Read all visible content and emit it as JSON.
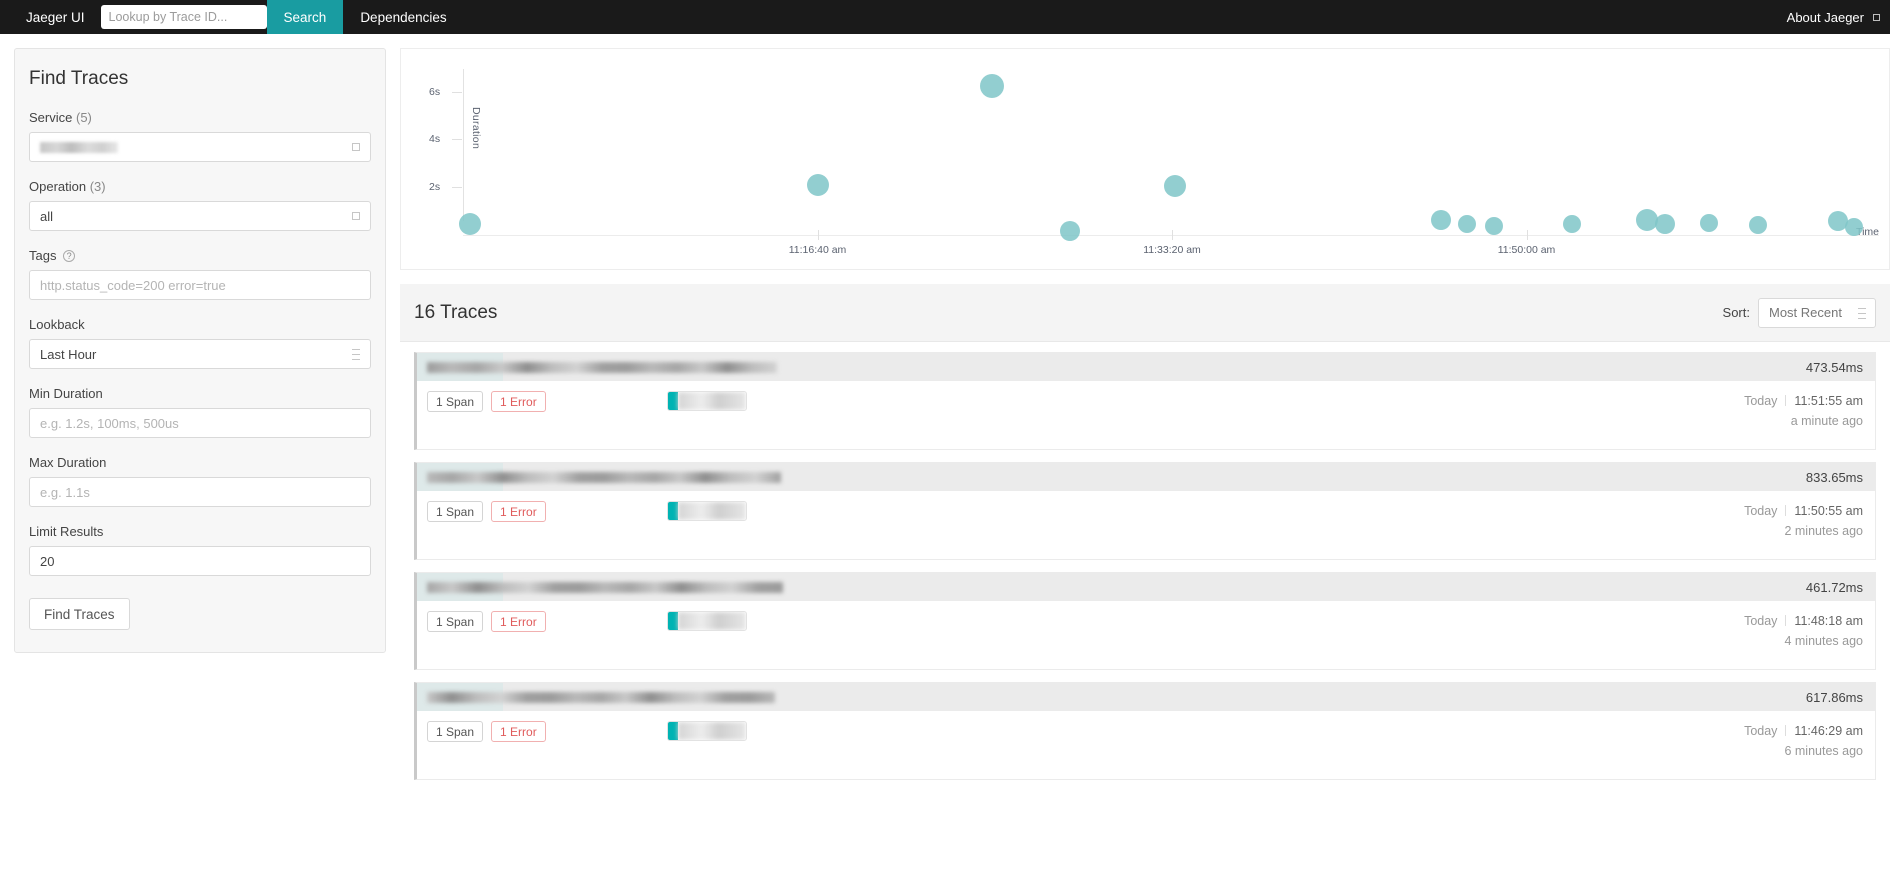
{
  "nav": {
    "brand": "Jaeger UI",
    "trace_id_placeholder": "Lookup by Trace ID...",
    "search_label": "Search",
    "dependencies_label": "Dependencies",
    "about_label": "About Jaeger"
  },
  "sidebar": {
    "title": "Find Traces",
    "service": {
      "label": "Service",
      "count": "(5)",
      "value": ""
    },
    "operation": {
      "label": "Operation",
      "count": "(3)",
      "value": "all"
    },
    "tags": {
      "label": "Tags",
      "placeholder": "http.status_code=200 error=true",
      "value": ""
    },
    "lookback": {
      "label": "Lookback",
      "value": "Last Hour"
    },
    "min_duration": {
      "label": "Min Duration",
      "placeholder": "e.g. 1.2s, 100ms, 500us",
      "value": ""
    },
    "max_duration": {
      "label": "Max Duration",
      "placeholder": "e.g. 1.1s",
      "value": ""
    },
    "limit_results": {
      "label": "Limit Results",
      "value": "20"
    },
    "find_button": "Find Traces"
  },
  "chart_data": {
    "type": "scatter",
    "title": "",
    "xlabel": "Time",
    "ylabel": "Duration",
    "grid": false,
    "legend": "none",
    "y_ticks": [
      "2s",
      "4s",
      "6s"
    ],
    "y_tick_values": [
      2,
      4,
      6
    ],
    "ylim": [
      0,
      7
    ],
    "x_ticks": [
      "11:16:40 am",
      "11:33:20 am",
      "11:50:00 am"
    ],
    "x_tick_positions_pct": [
      25.0,
      50.0,
      75.0
    ],
    "point_color": "#7fc5c8",
    "points": [
      {
        "x_pct": 0.5,
        "duration_s": 0.47,
        "r": 11
      },
      {
        "x_pct": 25.0,
        "duration_s": 2.1,
        "r": 11
      },
      {
        "x_pct": 37.3,
        "duration_s": 6.3,
        "r": 12
      },
      {
        "x_pct": 42.8,
        "duration_s": 0.15,
        "r": 10
      },
      {
        "x_pct": 50.2,
        "duration_s": 2.05,
        "r": 11
      },
      {
        "x_pct": 69.0,
        "duration_s": 0.62,
        "r": 10
      },
      {
        "x_pct": 70.8,
        "duration_s": 0.47,
        "r": 9
      },
      {
        "x_pct": 72.7,
        "duration_s": 0.4,
        "r": 9
      },
      {
        "x_pct": 78.2,
        "duration_s": 0.46,
        "r": 9
      },
      {
        "x_pct": 83.5,
        "duration_s": 0.62,
        "r": 11
      },
      {
        "x_pct": 84.8,
        "duration_s": 0.45,
        "r": 10
      },
      {
        "x_pct": 87.9,
        "duration_s": 0.5,
        "r": 9
      },
      {
        "x_pct": 91.3,
        "duration_s": 0.43,
        "r": 9
      },
      {
        "x_pct": 97.0,
        "duration_s": 0.58,
        "r": 10
      },
      {
        "x_pct": 98.1,
        "duration_s": 0.33,
        "r": 9
      }
    ]
  },
  "results": {
    "count_label": "16 Traces",
    "sort_label": "Sort:",
    "sort_value": "Most Recent",
    "traces": [
      {
        "title_redacted": true,
        "title_width": 350,
        "duration": "473.54ms",
        "spans": "1 Span",
        "errors": "1 Error",
        "day": "Today",
        "time": "11:51:55 am",
        "relative": "a minute ago"
      },
      {
        "title_redacted": true,
        "title_width": 354,
        "duration": "833.65ms",
        "spans": "1 Span",
        "errors": "1 Error",
        "day": "Today",
        "time": "11:50:55 am",
        "relative": "2 minutes ago"
      },
      {
        "title_redacted": true,
        "title_width": 356,
        "duration": "461.72ms",
        "spans": "1 Span",
        "errors": "1 Error",
        "day": "Today",
        "time": "11:48:18 am",
        "relative": "4 minutes ago"
      },
      {
        "title_redacted": true,
        "title_width": 348,
        "duration": "617.86ms",
        "spans": "1 Span",
        "errors": "1 Error",
        "day": "Today",
        "time": "11:46:29 am",
        "relative": "6 minutes ago"
      }
    ]
  }
}
